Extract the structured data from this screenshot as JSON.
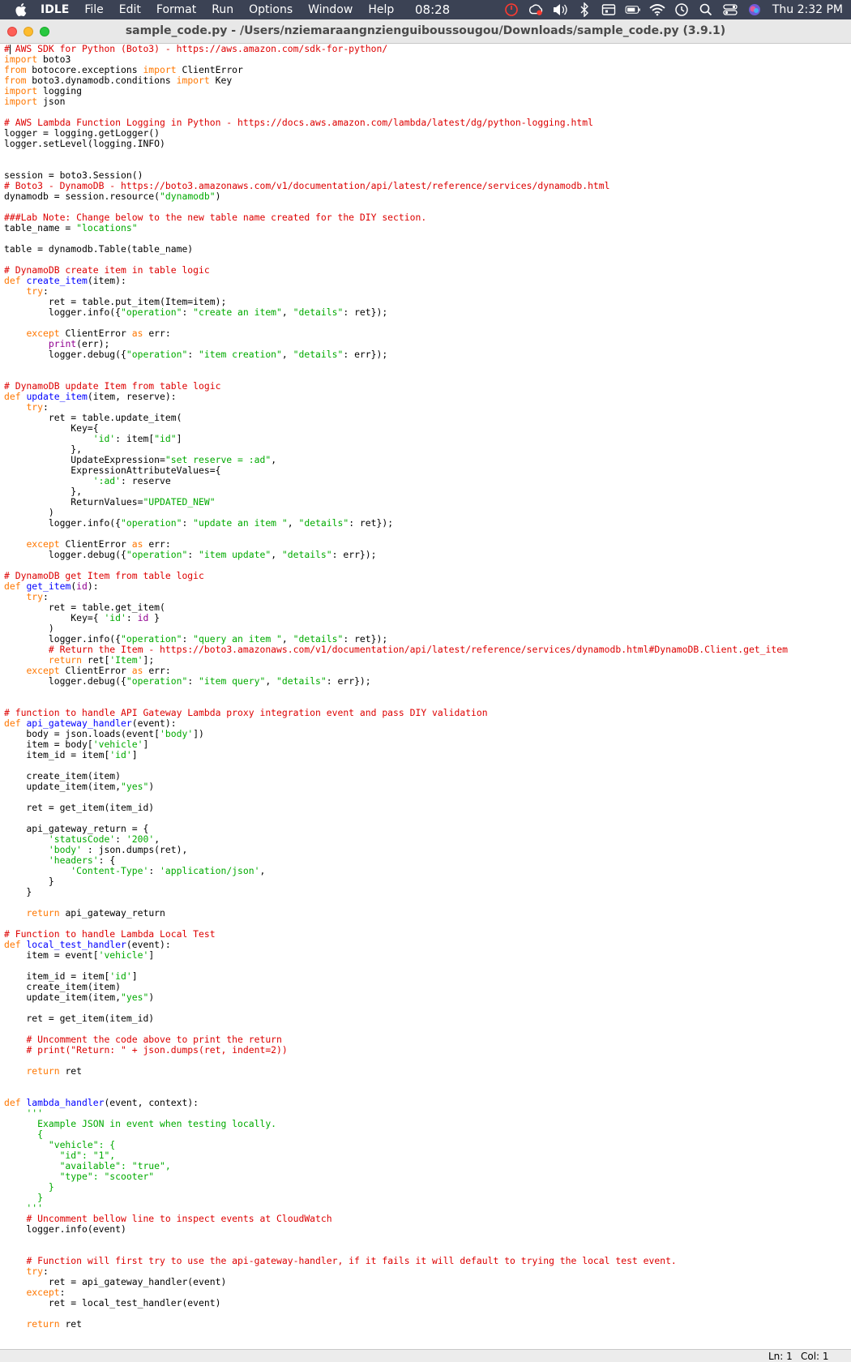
{
  "menubar": {
    "app_name": "IDLE",
    "menu_items": [
      "File",
      "Edit",
      "Format",
      "Run",
      "Options",
      "Window",
      "Help"
    ],
    "clock_center": "08:28",
    "clock_right": "Thu 2:32 PM",
    "status_icons": [
      "stopwatch-icon",
      "creative-cloud-icon",
      "volume-icon",
      "bluetooth-icon",
      "calendar-icon",
      "battery-icon",
      "wifi-icon",
      "time-machine-icon",
      "search-icon",
      "control-center-icon",
      "siri-icon"
    ]
  },
  "window": {
    "title": "sample_code.py - /Users/nziemaraangnzienguiboussougou/Downloads/sample_code.py (3.9.1)"
  },
  "statusbar": {
    "ln": "Ln: 1",
    "col": "Col: 1"
  },
  "code_lines": [
    [
      [
        "c",
        "# AWS SDK for Python (Boto3) - https://aws.amazon.com/sdk-for-python/"
      ]
    ],
    [
      [
        "k",
        "import"
      ],
      [
        "n",
        " boto3"
      ]
    ],
    [
      [
        "k",
        "from"
      ],
      [
        "n",
        " botocore.exceptions "
      ],
      [
        "k",
        "import"
      ],
      [
        "n",
        " ClientError"
      ]
    ],
    [
      [
        "k",
        "from"
      ],
      [
        "n",
        " boto3.dynamodb.conditions "
      ],
      [
        "k",
        "import"
      ],
      [
        "n",
        " Key"
      ]
    ],
    [
      [
        "k",
        "import"
      ],
      [
        "n",
        " logging"
      ]
    ],
    [
      [
        "k",
        "import"
      ],
      [
        "n",
        " json"
      ]
    ],
    [],
    [
      [
        "c",
        "# AWS Lambda Function Logging in Python - https://docs.aws.amazon.com/lambda/latest/dg/python-logging.html"
      ]
    ],
    [
      [
        "n",
        "logger = logging.getLogger()"
      ]
    ],
    [
      [
        "n",
        "logger.setLevel(logging.INFO)"
      ]
    ],
    [],
    [],
    [
      [
        "n",
        "session = boto3.Session()"
      ]
    ],
    [
      [
        "c",
        "# Boto3 - DynamoDB - https://boto3.amazonaws.com/v1/documentation/api/latest/reference/services/dynamodb.html"
      ]
    ],
    [
      [
        "n",
        "dynamodb = session.resource("
      ],
      [
        "s",
        "\"dynamodb\""
      ],
      [
        "n",
        ")"
      ]
    ],
    [],
    [
      [
        "c",
        "###Lab Note: Change below to the new table name created for the DIY section."
      ]
    ],
    [
      [
        "n",
        "table_name = "
      ],
      [
        "s",
        "\"locations\""
      ]
    ],
    [],
    [
      [
        "n",
        "table = dynamodb.Table(table_name)"
      ]
    ],
    [],
    [
      [
        "c",
        "# DynamoDB create item in table logic"
      ]
    ],
    [
      [
        "k",
        "def"
      ],
      [
        "n",
        " "
      ],
      [
        "d",
        "create_item"
      ],
      [
        "n",
        "(item):"
      ]
    ],
    [
      [
        "n",
        "    "
      ],
      [
        "k",
        "try"
      ],
      [
        "n",
        ":"
      ]
    ],
    [
      [
        "n",
        "        ret = table.put_item(Item=item);"
      ]
    ],
    [
      [
        "n",
        "        logger.info({"
      ],
      [
        "s",
        "\"operation\""
      ],
      [
        "n",
        ": "
      ],
      [
        "s",
        "\"create an item\""
      ],
      [
        "n",
        ", "
      ],
      [
        "s",
        "\"details\""
      ],
      [
        "n",
        ": ret});"
      ]
    ],
    [],
    [
      [
        "n",
        "    "
      ],
      [
        "k",
        "except"
      ],
      [
        "n",
        " ClientError "
      ],
      [
        "k",
        "as"
      ],
      [
        "n",
        " err:"
      ]
    ],
    [
      [
        "n",
        "        "
      ],
      [
        "b",
        "print"
      ],
      [
        "n",
        "(err);"
      ]
    ],
    [
      [
        "n",
        "        logger.debug({"
      ],
      [
        "s",
        "\"operation\""
      ],
      [
        "n",
        ": "
      ],
      [
        "s",
        "\"item creation\""
      ],
      [
        "n",
        ", "
      ],
      [
        "s",
        "\"details\""
      ],
      [
        "n",
        ": err});"
      ]
    ],
    [],
    [],
    [
      [
        "c",
        "# DynamoDB update Item from table logic"
      ]
    ],
    [
      [
        "k",
        "def"
      ],
      [
        "n",
        " "
      ],
      [
        "d",
        "update_item"
      ],
      [
        "n",
        "(item, reserve):"
      ]
    ],
    [
      [
        "n",
        "    "
      ],
      [
        "k",
        "try"
      ],
      [
        "n",
        ":"
      ]
    ],
    [
      [
        "n",
        "        ret = table.update_item("
      ]
    ],
    [
      [
        "n",
        "            Key={"
      ]
    ],
    [
      [
        "n",
        "                "
      ],
      [
        "s",
        "'id'"
      ],
      [
        "n",
        ": item["
      ],
      [
        "s",
        "\"id\""
      ],
      [
        "n",
        "]"
      ]
    ],
    [
      [
        "n",
        "            },"
      ]
    ],
    [
      [
        "n",
        "            UpdateExpression="
      ],
      [
        "s",
        "\"set reserve = :ad\""
      ],
      [
        "n",
        ","
      ]
    ],
    [
      [
        "n",
        "            ExpressionAttributeValues={"
      ]
    ],
    [
      [
        "n",
        "                "
      ],
      [
        "s",
        "':ad'"
      ],
      [
        "n",
        ": reserve"
      ]
    ],
    [
      [
        "n",
        "            },"
      ]
    ],
    [
      [
        "n",
        "            ReturnValues="
      ],
      [
        "s",
        "\"UPDATED_NEW\""
      ]
    ],
    [
      [
        "n",
        "        )"
      ]
    ],
    [
      [
        "n",
        "        logger.info({"
      ],
      [
        "s",
        "\"operation\""
      ],
      [
        "n",
        ": "
      ],
      [
        "s",
        "\"update an item \""
      ],
      [
        "n",
        ", "
      ],
      [
        "s",
        "\"details\""
      ],
      [
        "n",
        ": ret});"
      ]
    ],
    [],
    [
      [
        "n",
        "    "
      ],
      [
        "k",
        "except"
      ],
      [
        "n",
        " ClientError "
      ],
      [
        "k",
        "as"
      ],
      [
        "n",
        " err:"
      ]
    ],
    [
      [
        "n",
        "        logger.debug({"
      ],
      [
        "s",
        "\"operation\""
      ],
      [
        "n",
        ": "
      ],
      [
        "s",
        "\"item update\""
      ],
      [
        "n",
        ", "
      ],
      [
        "s",
        "\"details\""
      ],
      [
        "n",
        ": err});"
      ]
    ],
    [],
    [
      [
        "c",
        "# DynamoDB get Item from table logic"
      ]
    ],
    [
      [
        "k",
        "def"
      ],
      [
        "n",
        " "
      ],
      [
        "d",
        "get_item"
      ],
      [
        "n",
        "("
      ],
      [
        "b",
        "id"
      ],
      [
        "n",
        "):"
      ]
    ],
    [
      [
        "n",
        "    "
      ],
      [
        "k",
        "try"
      ],
      [
        "n",
        ":"
      ]
    ],
    [
      [
        "n",
        "        ret = table.get_item("
      ]
    ],
    [
      [
        "n",
        "            Key={ "
      ],
      [
        "s",
        "'id'"
      ],
      [
        "n",
        ": "
      ],
      [
        "b",
        "id"
      ],
      [
        "n",
        " }"
      ]
    ],
    [
      [
        "n",
        "        )"
      ]
    ],
    [
      [
        "n",
        "        logger.info({"
      ],
      [
        "s",
        "\"operation\""
      ],
      [
        "n",
        ": "
      ],
      [
        "s",
        "\"query an item \""
      ],
      [
        "n",
        ", "
      ],
      [
        "s",
        "\"details\""
      ],
      [
        "n",
        ": ret});"
      ]
    ],
    [
      [
        "n",
        "        "
      ],
      [
        "c",
        "# Return the Item - https://boto3.amazonaws.com/v1/documentation/api/latest/reference/services/dynamodb.html#DynamoDB.Client.get_item"
      ]
    ],
    [
      [
        "n",
        "        "
      ],
      [
        "k",
        "return"
      ],
      [
        "n",
        " ret["
      ],
      [
        "s",
        "'Item'"
      ],
      [
        "n",
        "];"
      ]
    ],
    [
      [
        "n",
        "    "
      ],
      [
        "k",
        "except"
      ],
      [
        "n",
        " ClientError "
      ],
      [
        "k",
        "as"
      ],
      [
        "n",
        " err:"
      ]
    ],
    [
      [
        "n",
        "        logger.debug({"
      ],
      [
        "s",
        "\"operation\""
      ],
      [
        "n",
        ": "
      ],
      [
        "s",
        "\"item query\""
      ],
      [
        "n",
        ", "
      ],
      [
        "s",
        "\"details\""
      ],
      [
        "n",
        ": err});"
      ]
    ],
    [],
    [],
    [
      [
        "c",
        "# function to handle API Gateway Lambda proxy integration event and pass DIY validation"
      ]
    ],
    [
      [
        "k",
        "def"
      ],
      [
        "n",
        " "
      ],
      [
        "d",
        "api_gateway_handler"
      ],
      [
        "n",
        "(event):"
      ]
    ],
    [
      [
        "n",
        "    body = json.loads(event["
      ],
      [
        "s",
        "'body'"
      ],
      [
        "n",
        "])"
      ]
    ],
    [
      [
        "n",
        "    item = body["
      ],
      [
        "s",
        "'vehicle'"
      ],
      [
        "n",
        "]"
      ]
    ],
    [
      [
        "n",
        "    item_id = item["
      ],
      [
        "s",
        "'id'"
      ],
      [
        "n",
        "]"
      ]
    ],
    [],
    [
      [
        "n",
        "    create_item(item)"
      ]
    ],
    [
      [
        "n",
        "    update_item(item,"
      ],
      [
        "s",
        "\"yes\""
      ],
      [
        "n",
        ")"
      ]
    ],
    [],
    [
      [
        "n",
        "    ret = get_item(item_id)"
      ]
    ],
    [],
    [
      [
        "n",
        "    api_gateway_return = {"
      ]
    ],
    [
      [
        "n",
        "        "
      ],
      [
        "s",
        "'statusCode'"
      ],
      [
        "n",
        ": "
      ],
      [
        "s",
        "'200'"
      ],
      [
        "n",
        ","
      ]
    ],
    [
      [
        "n",
        "        "
      ],
      [
        "s",
        "'body'"
      ],
      [
        "n",
        " : json.dumps(ret),"
      ]
    ],
    [
      [
        "n",
        "        "
      ],
      [
        "s",
        "'headers'"
      ],
      [
        "n",
        ": {"
      ]
    ],
    [
      [
        "n",
        "            "
      ],
      [
        "s",
        "'Content-Type'"
      ],
      [
        "n",
        ": "
      ],
      [
        "s",
        "'application/json'"
      ],
      [
        "n",
        ","
      ]
    ],
    [
      [
        "n",
        "        }"
      ]
    ],
    [
      [
        "n",
        "    }"
      ]
    ],
    [],
    [
      [
        "n",
        "    "
      ],
      [
        "k",
        "return"
      ],
      [
        "n",
        " api_gateway_return"
      ]
    ],
    [],
    [
      [
        "c",
        "# Function to handle Lambda Local Test"
      ]
    ],
    [
      [
        "k",
        "def"
      ],
      [
        "n",
        " "
      ],
      [
        "d",
        "local_test_handler"
      ],
      [
        "n",
        "(event):"
      ]
    ],
    [
      [
        "n",
        "    item = event["
      ],
      [
        "s",
        "'vehicle'"
      ],
      [
        "n",
        "]"
      ]
    ],
    [],
    [
      [
        "n",
        "    item_id = item["
      ],
      [
        "s",
        "'id'"
      ],
      [
        "n",
        "]"
      ]
    ],
    [
      [
        "n",
        "    create_item(item)"
      ]
    ],
    [
      [
        "n",
        "    update_item(item,"
      ],
      [
        "s",
        "\"yes\""
      ],
      [
        "n",
        ")"
      ]
    ],
    [],
    [
      [
        "n",
        "    ret = get_item(item_id)"
      ]
    ],
    [],
    [
      [
        "n",
        "    "
      ],
      [
        "c",
        "# Uncomment the code above to print the return"
      ]
    ],
    [
      [
        "n",
        "    "
      ],
      [
        "c",
        "# print(\"Return: \" + json.dumps(ret, indent=2))"
      ]
    ],
    [],
    [
      [
        "n",
        "    "
      ],
      [
        "k",
        "return"
      ],
      [
        "n",
        " ret"
      ]
    ],
    [],
    [],
    [
      [
        "k",
        "def"
      ],
      [
        "n",
        " "
      ],
      [
        "d",
        "lambda_handler"
      ],
      [
        "n",
        "(event, context):"
      ]
    ],
    [
      [
        "n",
        "    "
      ],
      [
        "s",
        "'''"
      ]
    ],
    [
      [
        "s",
        "      Example JSON in event when testing locally."
      ]
    ],
    [
      [
        "s",
        "      {"
      ]
    ],
    [
      [
        "s",
        "        \"vehicle\": {"
      ]
    ],
    [
      [
        "s",
        "          \"id\": \"1\","
      ]
    ],
    [
      [
        "s",
        "          \"available\": \"true\","
      ]
    ],
    [
      [
        "s",
        "          \"type\": \"scooter\""
      ]
    ],
    [
      [
        "s",
        "        }"
      ]
    ],
    [
      [
        "s",
        "      }"
      ]
    ],
    [
      [
        "s",
        "    '''"
      ]
    ],
    [
      [
        "n",
        "    "
      ],
      [
        "c",
        "# Uncomment bellow line to inspect events at CloudWatch"
      ]
    ],
    [
      [
        "n",
        "    logger.info(event)"
      ]
    ],
    [],
    [],
    [
      [
        "n",
        "    "
      ],
      [
        "c",
        "# Function will first try to use the api-gateway-handler, if it fails it will default to trying the local test event."
      ]
    ],
    [
      [
        "n",
        "    "
      ],
      [
        "k",
        "try"
      ],
      [
        "n",
        ":"
      ]
    ],
    [
      [
        "n",
        "        ret = api_gateway_handler(event)"
      ]
    ],
    [
      [
        "n",
        "    "
      ],
      [
        "k",
        "except"
      ],
      [
        "n",
        ":"
      ]
    ],
    [
      [
        "n",
        "        ret = local_test_handler(event)"
      ]
    ],
    [],
    [
      [
        "n",
        "    "
      ],
      [
        "k",
        "return"
      ],
      [
        "n",
        " ret"
      ]
    ]
  ],
  "colors": {
    "comment": "#dd0000",
    "keyword": "#ff7700",
    "string": "#00aa00",
    "definition": "#0000ff",
    "builtin": "#900090",
    "menubar_bg": "#3b4254"
  }
}
